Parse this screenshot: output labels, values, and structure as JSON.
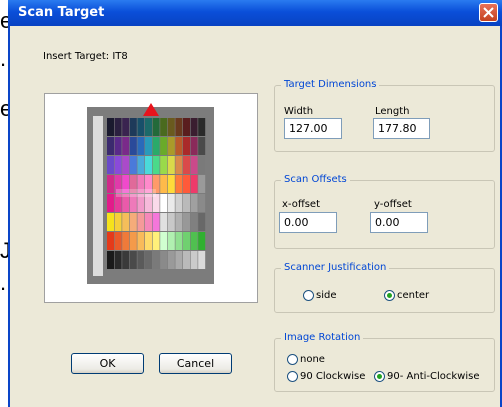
{
  "background_fragments": [
    "e",
    ".",
    "e",
    "J",
    "."
  ],
  "window": {
    "title": "Scan Target"
  },
  "insert_target_label": "Insert Target: IT8",
  "target_dimensions": {
    "legend": "Target Dimensions",
    "width_label": "Width",
    "width_value": "127.00",
    "length_label": "Length",
    "length_value": "177.80"
  },
  "scan_offsets": {
    "legend": "Scan Offsets",
    "x_label": "x-offset",
    "x_value": "0.00",
    "y_label": "y-offset",
    "y_value": "0.00"
  },
  "scanner_justification": {
    "legend": "Scanner Justification",
    "options": [
      {
        "label": "side",
        "selected": false
      },
      {
        "label": "center",
        "selected": true
      }
    ]
  },
  "image_rotation": {
    "legend": "Image Rotation",
    "options": [
      {
        "label": "none",
        "selected": false
      },
      {
        "label": "90 Clockwise",
        "selected": false
      },
      {
        "label": "90- Anti-Clockwise",
        "selected": true
      }
    ]
  },
  "buttons": {
    "ok": "OK",
    "cancel": "Cancel"
  },
  "icons": {
    "close": "close-icon",
    "marker": "triangle-marker-icon"
  },
  "colors": {
    "title_bar": "#0a4fd9",
    "legend_text": "#0046d5",
    "marker": "#e8141c",
    "dialog_bg": "#ece9d8"
  }
}
